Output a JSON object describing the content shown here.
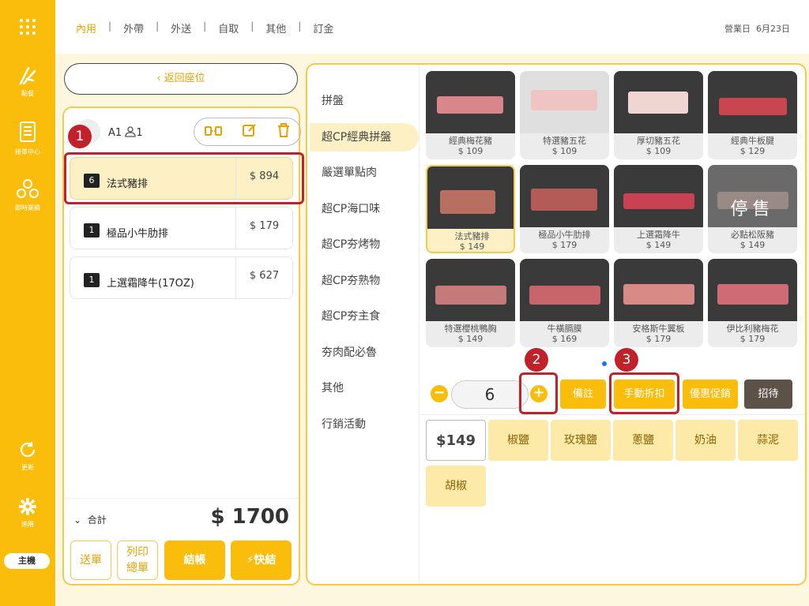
{
  "sidebar": {
    "items": [
      {
        "icon": "apps-grid-icon",
        "label": ""
      },
      {
        "icon": "order-icon",
        "label": "點餐"
      },
      {
        "icon": "receipt-icon",
        "label": "接單中心"
      },
      {
        "icon": "sales-icon",
        "label": "即時業績"
      },
      {
        "icon": "refresh-icon",
        "label": "更新"
      },
      {
        "icon": "gear-icon",
        "label": "進階"
      }
    ],
    "host_label": "主機"
  },
  "topbar": {
    "tabs": [
      "內用",
      "外帶",
      "外送",
      "自取",
      "其他",
      "訂金"
    ],
    "active_tab": "內用",
    "business_day_label": "營業日",
    "business_day": "6月23日"
  },
  "order": {
    "back_label": "返回座位",
    "seat": "A1",
    "guests": "1",
    "items": [
      {
        "qty": "6",
        "name": "法式豬排",
        "price": "$ 894"
      },
      {
        "qty": "1",
        "name": "極品小牛肋排",
        "price": "$ 179"
      },
      {
        "qty": "1",
        "name": "上選霜降牛(17OZ)",
        "price": "$ 627"
      }
    ],
    "total_label": "合計",
    "total": "$ 1700",
    "buttons": {
      "send": "送單",
      "print_line1": "列印",
      "print_line2": "總單",
      "checkout": "結帳",
      "quick": "快結"
    }
  },
  "categories": [
    "拼盤",
    "超CP經典拼盤",
    "嚴選單點肉",
    "超CP海口味",
    "超CP夯烤物",
    "超CP夯熟物",
    "超CP夯主食",
    "夯肉配必魯",
    "其他",
    "行銷活動"
  ],
  "active_category": "超CP經典拼盤",
  "products": [
    {
      "name": "經典梅花豬",
      "price": "$ 109"
    },
    {
      "name": "特選豬五花",
      "price": "$ 109"
    },
    {
      "name": "厚切豬五花",
      "price": "$ 109"
    },
    {
      "name": "經典牛板腱",
      "price": "$ 129"
    },
    {
      "name": "法式豬排",
      "price": "$ 149"
    },
    {
      "name": "極品小牛肋排",
      "price": "$ 179"
    },
    {
      "name": "上選霜降牛",
      "price": "$ 149"
    },
    {
      "name": "必點松阪豬",
      "price": "$ 149",
      "status": "停售"
    },
    {
      "name": "特選櫻桃鴨胸",
      "price": "$ 149"
    },
    {
      "name": "牛橫膈膜",
      "price": "$ 169"
    },
    {
      "name": "安格斯牛翼板",
      "price": "$ 179"
    },
    {
      "name": "伊比利豬梅花",
      "price": "$ 179"
    }
  ],
  "quantity": "6",
  "actions": {
    "note": "備註",
    "manual_discount": "手動折扣",
    "promo": "優惠促銷",
    "treat": "招待"
  },
  "seasonings": {
    "price": "$149",
    "options": [
      "椒鹽",
      "玫瑰鹽",
      "蔥鹽",
      "奶油",
      "蒜泥",
      "胡椒"
    ]
  },
  "callouts": [
    "1",
    "2",
    "3"
  ]
}
